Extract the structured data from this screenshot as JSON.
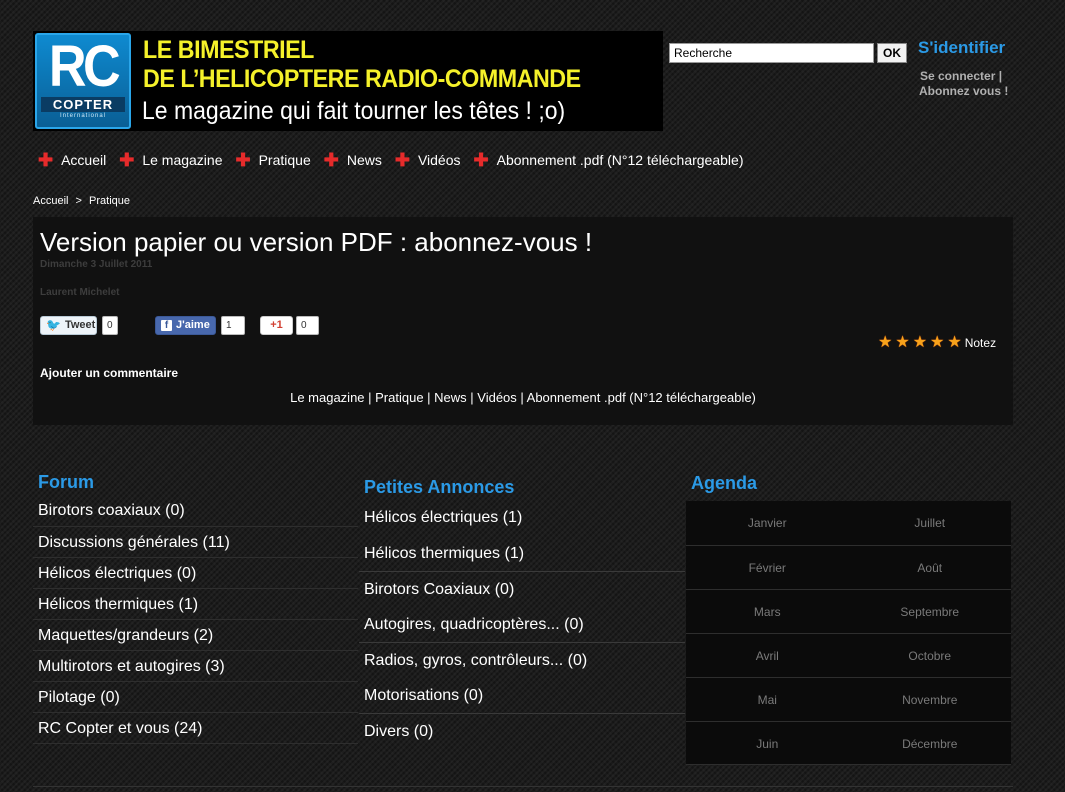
{
  "banner": {
    "logo_rc": "RC",
    "logo_copter": "COPTER",
    "logo_intl": "International",
    "line1": "LE BIMESTRIEL",
    "line2": "DE L’HELICOPTERE RADIO-COMMANDE",
    "line3": "Le magazine qui fait tourner les têtes ! ;o)"
  },
  "search": {
    "value": "Recherche",
    "button_label": "OK"
  },
  "login": {
    "title": "S'identifier",
    "connect": "Se connecter |",
    "subscribe": "Abonnez vous !"
  },
  "nav": {
    "items": [
      {
        "label": "Accueil"
      },
      {
        "label": "Le magazine"
      },
      {
        "label": "Pratique"
      },
      {
        "label": "News"
      },
      {
        "label": "Vidéos"
      },
      {
        "label": "Abonnement .pdf (N°12 téléchargeable)"
      }
    ]
  },
  "breadcrumb": {
    "home": "Accueil",
    "separator": ">",
    "current": "Pratique"
  },
  "article": {
    "title": "Version papier ou version PDF : abonnez-vous !",
    "date": "Dimanche 3 Juillet 2011",
    "author": "Laurent Michelet",
    "share": {
      "tweet_label": "Tweet",
      "tweet_count": "0",
      "like_label": "J'aime",
      "like_count": "1",
      "gplus_label": "+1",
      "gplus_count": "0"
    },
    "rating": {
      "stars": 5,
      "label": "Notez"
    },
    "add_comment": "Ajouter un commentaire",
    "links": "Le magazine | Pratique | News | Vidéos | Abonnement .pdf (N°12 téléchargeable)"
  },
  "forum": {
    "title": "Forum",
    "items": [
      {
        "label": "Birotors coaxiaux (0)"
      },
      {
        "label": "Discussions générales (11)"
      },
      {
        "label": "Hélicos électriques (0)"
      },
      {
        "label": "Hélicos thermiques (1)"
      },
      {
        "label": "Maquettes/grandeurs (2)"
      },
      {
        "label": "Multirotors et autogires (3)"
      },
      {
        "label": "Pilotage (0)"
      },
      {
        "label": "RC Copter et vous (24)"
      }
    ]
  },
  "ads": {
    "title": "Petites Annonces",
    "items": [
      {
        "label": "Hélicos électriques (1)"
      },
      {
        "label": "Hélicos thermiques (1)"
      },
      {
        "label": "Birotors Coaxiaux (0)"
      },
      {
        "label": "Autogires, quadricoptères... (0)"
      },
      {
        "label": "Radios, gyros, contrôleurs... (0)"
      },
      {
        "label": "Motorisations (0)"
      },
      {
        "label": "Divers (0)"
      }
    ]
  },
  "agenda": {
    "title": "Agenda",
    "rows": [
      {
        "left": "Janvier",
        "right": "Juillet"
      },
      {
        "left": "Février",
        "right": "Août"
      },
      {
        "left": "Mars",
        "right": "Septembre"
      },
      {
        "left": "Avril",
        "right": "Octobre"
      },
      {
        "left": "Mai",
        "right": "Novembre"
      },
      {
        "left": "Juin",
        "right": "Décembre"
      }
    ]
  },
  "colors": {
    "accent_blue": "#2b9ae6",
    "banner_yellow": "#f5f12a",
    "nav_plus_red": "#e62b2b",
    "star_orange": "#f7a21b"
  }
}
